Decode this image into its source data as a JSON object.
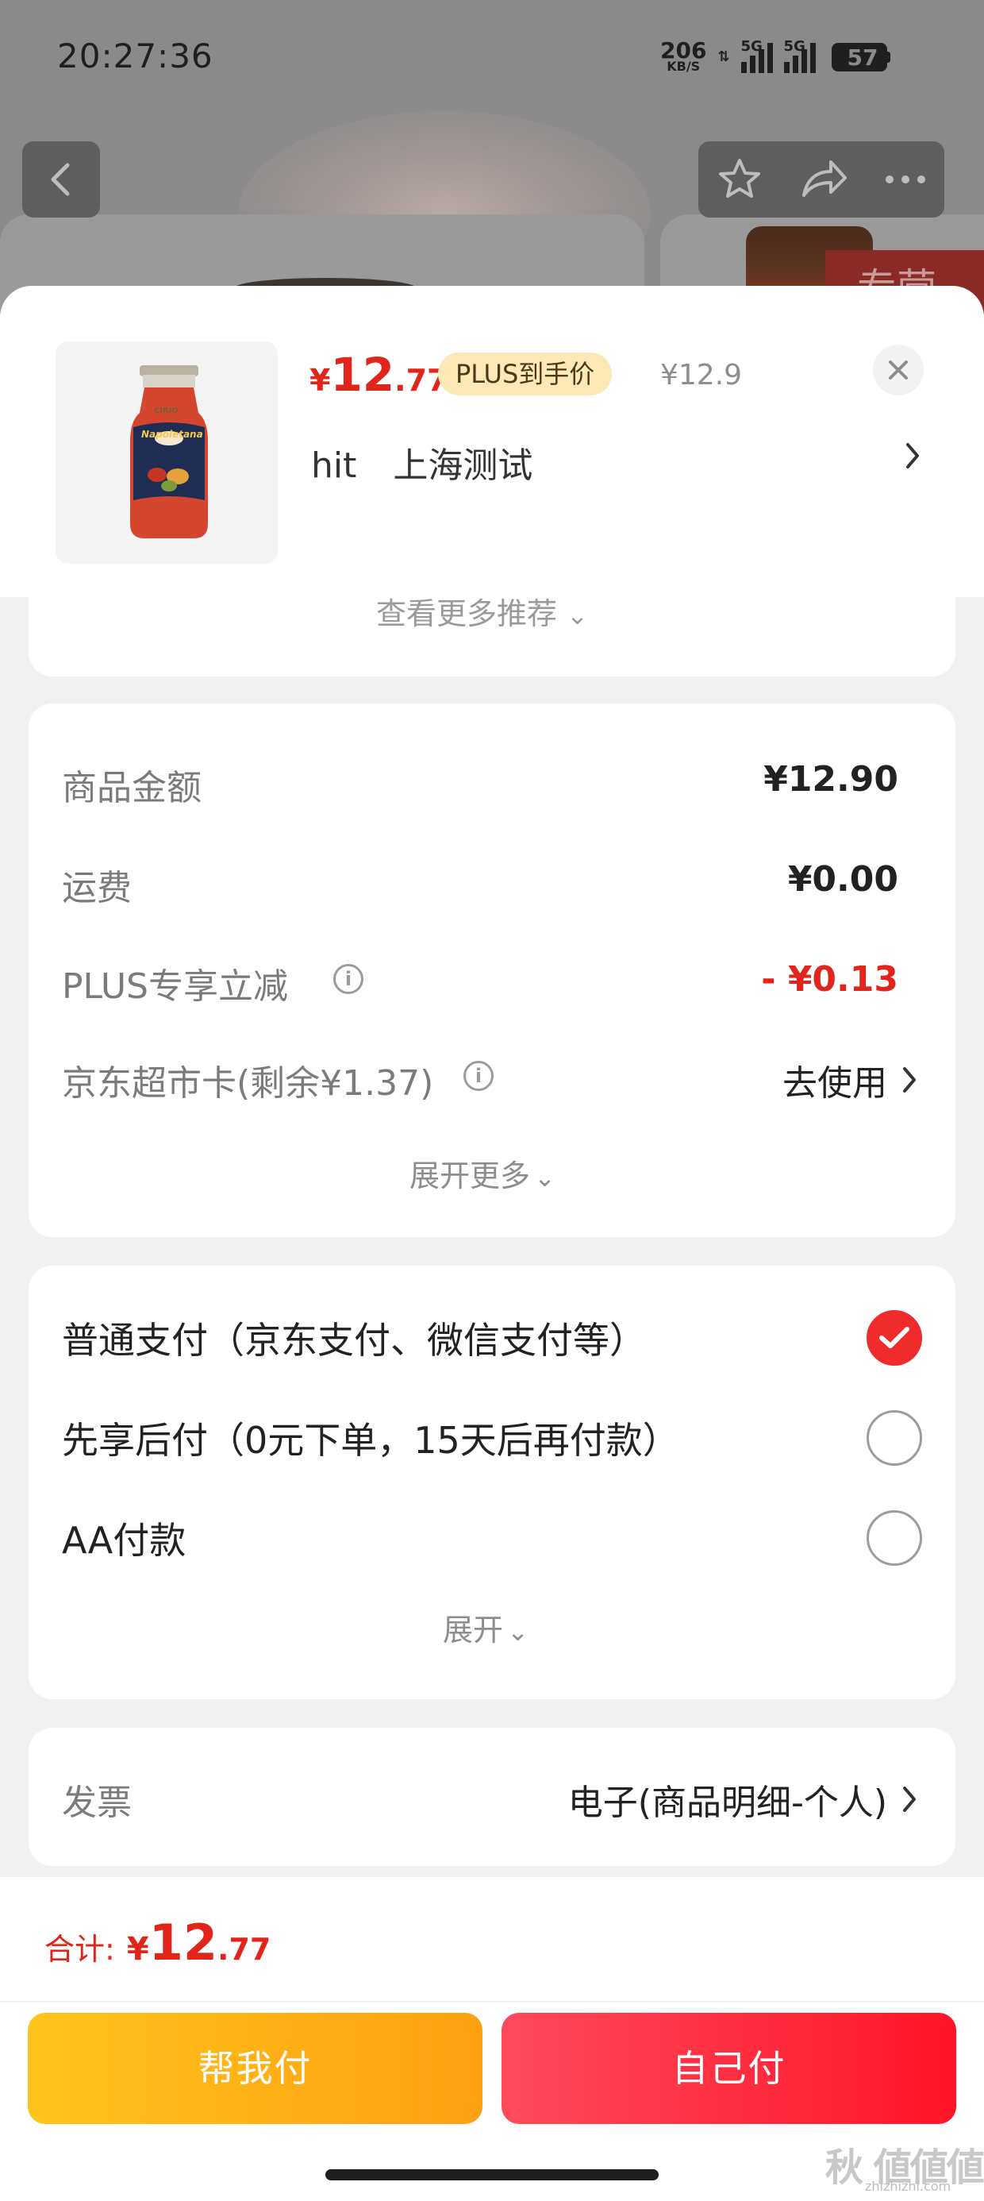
{
  "status_bar": {
    "time": "20:27:36",
    "net_speed": "206",
    "net_unit": "KB/S",
    "sim1_label": "5G",
    "sim2_label": "5G",
    "battery": "57"
  },
  "background": {
    "tag_text": "专营"
  },
  "product": {
    "price_symbol": "¥",
    "price_int": "12",
    "price_dec": ".77",
    "plus_tag": "PLUS到手价",
    "original_price": "¥12.9",
    "address_user": "hit",
    "address_place": "上海测试",
    "jar_brand": "CIRIO",
    "jar_name": "Napoletana"
  },
  "recommend": {
    "more_label": "查看更多推荐"
  },
  "cost": {
    "rows": [
      {
        "label": "商品金额",
        "value": "¥12.90"
      },
      {
        "label": "运费",
        "value": "¥0.00"
      },
      {
        "label": "PLUS专享立减",
        "value": "- ¥0.13"
      },
      {
        "label": "京东超市卡(剩余¥1.37)",
        "value": "去使用"
      }
    ],
    "expand_label": "展开更多"
  },
  "payment": {
    "options": [
      {
        "label": "普通支付（京东支付、微信支付等）",
        "selected": true
      },
      {
        "label": "先享后付（0元下单，15天后再付款）",
        "selected": false
      },
      {
        "label": "AA付款",
        "selected": false
      }
    ],
    "expand_label": "展开"
  },
  "invoice": {
    "label": "发票",
    "value": "电子(商品明细-个人)"
  },
  "footer": {
    "total_label": "合计:",
    "total_symbol": "¥",
    "total_int": "12",
    "total_dec": ".77",
    "help_pay_label": "帮我付",
    "self_pay_label": "自己付"
  },
  "watermark": {
    "text": "秋 値値値",
    "sub": "zhizhizhi.com"
  },
  "colors": {
    "accent_red": "#e1251b",
    "help_button": "#ffb015",
    "self_button": "#ff2a3c",
    "plus_tag_bg": "#fde9b6"
  }
}
